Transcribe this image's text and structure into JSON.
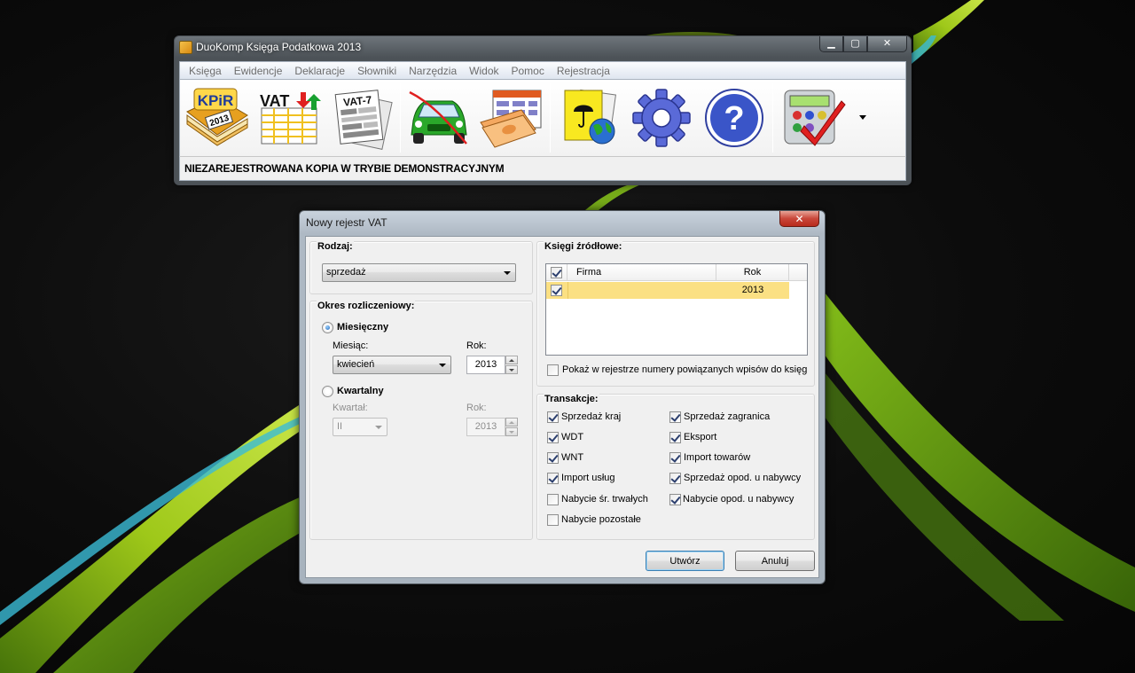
{
  "main_window": {
    "title": "DuoKomp Księga Podatkowa 2013",
    "controls": {
      "minimize": "▁",
      "maximize": "▢",
      "close": "✕"
    },
    "menu": [
      "Księga",
      "Ewidencje",
      "Deklaracje",
      "Słowniki",
      "Narzędzia",
      "Widok",
      "Pomoc",
      "Rejestracja"
    ],
    "toolbar": {
      "kpir_icon": {
        "name": "kpir-book-icon",
        "line1": "KPiR",
        "line2": "2013"
      },
      "vat_icon": {
        "name": "vat-register-icon",
        "label": "VAT"
      },
      "vat7_icon": {
        "name": "vat7-declaration-icon",
        "label": "VAT-7"
      },
      "car_icon": {
        "name": "car-icon"
      },
      "money_icon": {
        "name": "money-table-icon"
      },
      "docs_icon": {
        "name": "documents-globe-icon"
      },
      "settings_icon": {
        "name": "gear-icon"
      },
      "help_icon": {
        "name": "help-icon",
        "label": "?"
      },
      "calc_icon": {
        "name": "calculator-check-icon"
      }
    },
    "status": "NIEZAREJESTROWANA KOPIA W TRYBIE DEMONSTRACYJNYM"
  },
  "dialog": {
    "title": "Nowy rejestr VAT",
    "close_label": "✕",
    "rodzaj": {
      "title": "Rodzaj:",
      "value": "sprzedaż"
    },
    "okres": {
      "title": "Okres rozliczeniowy:",
      "monthly": {
        "label": "Miesięczny",
        "selected": true,
        "month_label": "Miesiąc:",
        "month_value": "kwiecień",
        "year_label": "Rok:",
        "year_value": "2013"
      },
      "quarterly": {
        "label": "Kwartalny",
        "selected": false,
        "quarter_label": "Kwartał:",
        "quarter_value": "II",
        "year_label": "Rok:",
        "year_value": "2013"
      }
    },
    "ksiegi": {
      "title": "Księgi źródłowe:",
      "columns": {
        "firma": "Firma",
        "rok": "Rok"
      },
      "rows": [
        {
          "checked": true,
          "firma": "",
          "rok": "2013"
        }
      ],
      "show_linked": {
        "label": "Pokaż w rejestrze numery powiązanych wpisów do księg",
        "checked": false
      }
    },
    "transakcje": {
      "title": "Transakcje:",
      "left": [
        {
          "label": "Sprzedaż kraj",
          "checked": true
        },
        {
          "label": "WDT",
          "checked": true
        },
        {
          "label": "WNT",
          "checked": true
        },
        {
          "label": "Import usług",
          "checked": true
        },
        {
          "label": "Nabycie śr. trwałych",
          "checked": false
        },
        {
          "label": "Nabycie pozostałe",
          "checked": false
        }
      ],
      "right": [
        {
          "label": "Sprzedaż zagranica",
          "checked": true
        },
        {
          "label": "Eksport",
          "checked": true
        },
        {
          "label": "Import towarów",
          "checked": true
        },
        {
          "label": "Sprzedaż opod. u nabywcy",
          "checked": true
        },
        {
          "label": "Nabycie opod. u nabywcy",
          "checked": true
        }
      ]
    },
    "buttons": {
      "create": "Utwórz",
      "cancel": "Anuluj"
    }
  }
}
